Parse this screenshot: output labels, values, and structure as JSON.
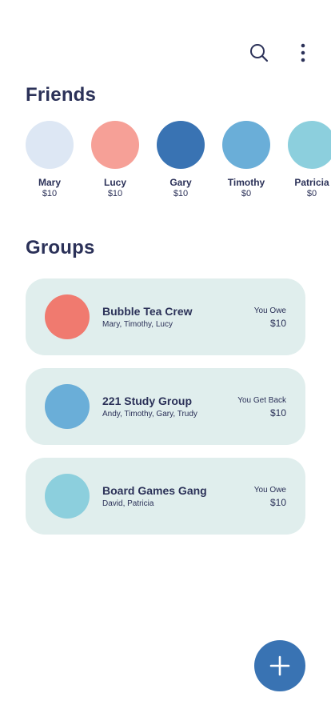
{
  "icons": {
    "search": "search-icon",
    "more": "more-vertical-icon",
    "add": "plus-icon"
  },
  "friends": {
    "title": "Friends",
    "items": [
      {
        "name": "Mary",
        "amount": "$10",
        "color": "#dde7f4"
      },
      {
        "name": "Lucy",
        "amount": "$10",
        "color": "#f6a097"
      },
      {
        "name": "Gary",
        "amount": "$10",
        "color": "#3973b3"
      },
      {
        "name": "Timothy",
        "amount": "$0",
        "color": "#6aaed8"
      },
      {
        "name": "Patricia",
        "amount": "$0",
        "color": "#8ccfdd"
      }
    ]
  },
  "groups": {
    "title": "Groups",
    "items": [
      {
        "name": "Bubble Tea Crew",
        "members": "Mary, Timothy, Lucy",
        "status": "You Owe",
        "amount": "$10",
        "color": "#f07a6f"
      },
      {
        "name": "221 Study Group",
        "members": "Andy, Timothy, Gary, Trudy",
        "status": "You Get Back",
        "amount": "$10",
        "color": "#6aaed8"
      },
      {
        "name": "Board Games Gang",
        "members": "David, Patricia",
        "status": "You Owe",
        "amount": "$10",
        "color": "#8ccfdd"
      }
    ]
  },
  "colors": {
    "text": "#2b3158",
    "card_bg": "#e0eeed",
    "fab": "#3973b3"
  }
}
